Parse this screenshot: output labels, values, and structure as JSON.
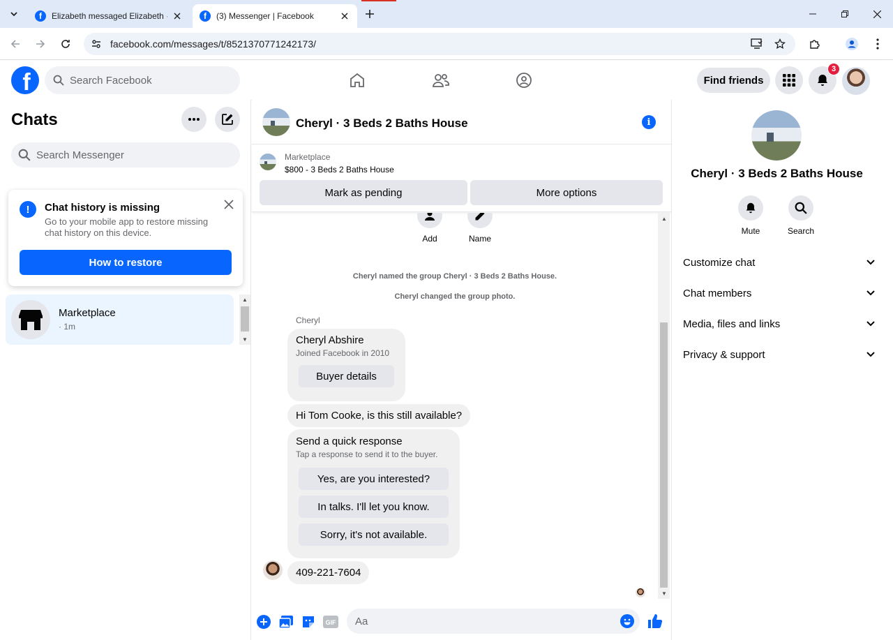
{
  "browser": {
    "tabs": [
      {
        "title": "Elizabeth messaged Elizabeth ·",
        "favicon": "facebook-icon"
      },
      {
        "title": "(3) Messenger | Facebook",
        "favicon": "facebook-icon",
        "active": true
      }
    ],
    "url": "facebook.com/messages/t/8521370771242173/"
  },
  "fb_header": {
    "logo": "f",
    "search_placeholder": "Search Facebook",
    "find_friends": "Find friends",
    "notification_count": "3",
    "accent": "#0866ff"
  },
  "sidebar": {
    "title": "Chats",
    "search_placeholder": "Search Messenger",
    "notice": {
      "icon": "!",
      "title": "Chat history is missing",
      "desc": "Go to your mobile app to restore missing chat history on this device.",
      "button": "How to restore"
    },
    "conversation": {
      "name": "Marketplace",
      "time": "· 1m"
    }
  },
  "chat": {
    "header_name": "Cheryl · 3 Beds 2 Baths House",
    "marketplace_label": "Marketplace",
    "listing": "$800 - 3 Beds 2 Baths House",
    "btn_pending": "Mark as pending",
    "btn_more": "More options",
    "actions": [
      {
        "label": "Add",
        "icon": "add-person-icon"
      },
      {
        "label": "Name",
        "icon": "pencil-icon"
      }
    ],
    "system_messages": [
      "Cheryl named the group Cheryl · 3 Beds 2 Baths House.",
      "Cheryl changed the group photo."
    ],
    "sender": "Cheryl",
    "buyer_card": {
      "name": "Cheryl Abshire",
      "sub": "Joined Facebook in 2010",
      "button": "Buyer details"
    },
    "message1": "Hi Tom Cooke, is this still available?",
    "quick": {
      "title": "Send a quick response",
      "sub": "Tap a response to send it to the buyer.",
      "options": [
        "Yes, are you interested?",
        "In talks. I'll let you know.",
        "Sorry, it's not available."
      ]
    },
    "message2": "409-221-7604",
    "composer_placeholder": "Aa"
  },
  "details": {
    "name": "Cheryl · 3 Beds 2 Baths House",
    "actions": [
      {
        "label": "Mute",
        "icon": "bell-icon"
      },
      {
        "label": "Search",
        "icon": "search-icon"
      }
    ],
    "sections": [
      "Customize chat",
      "Chat members",
      "Media, files and links",
      "Privacy & support"
    ]
  }
}
